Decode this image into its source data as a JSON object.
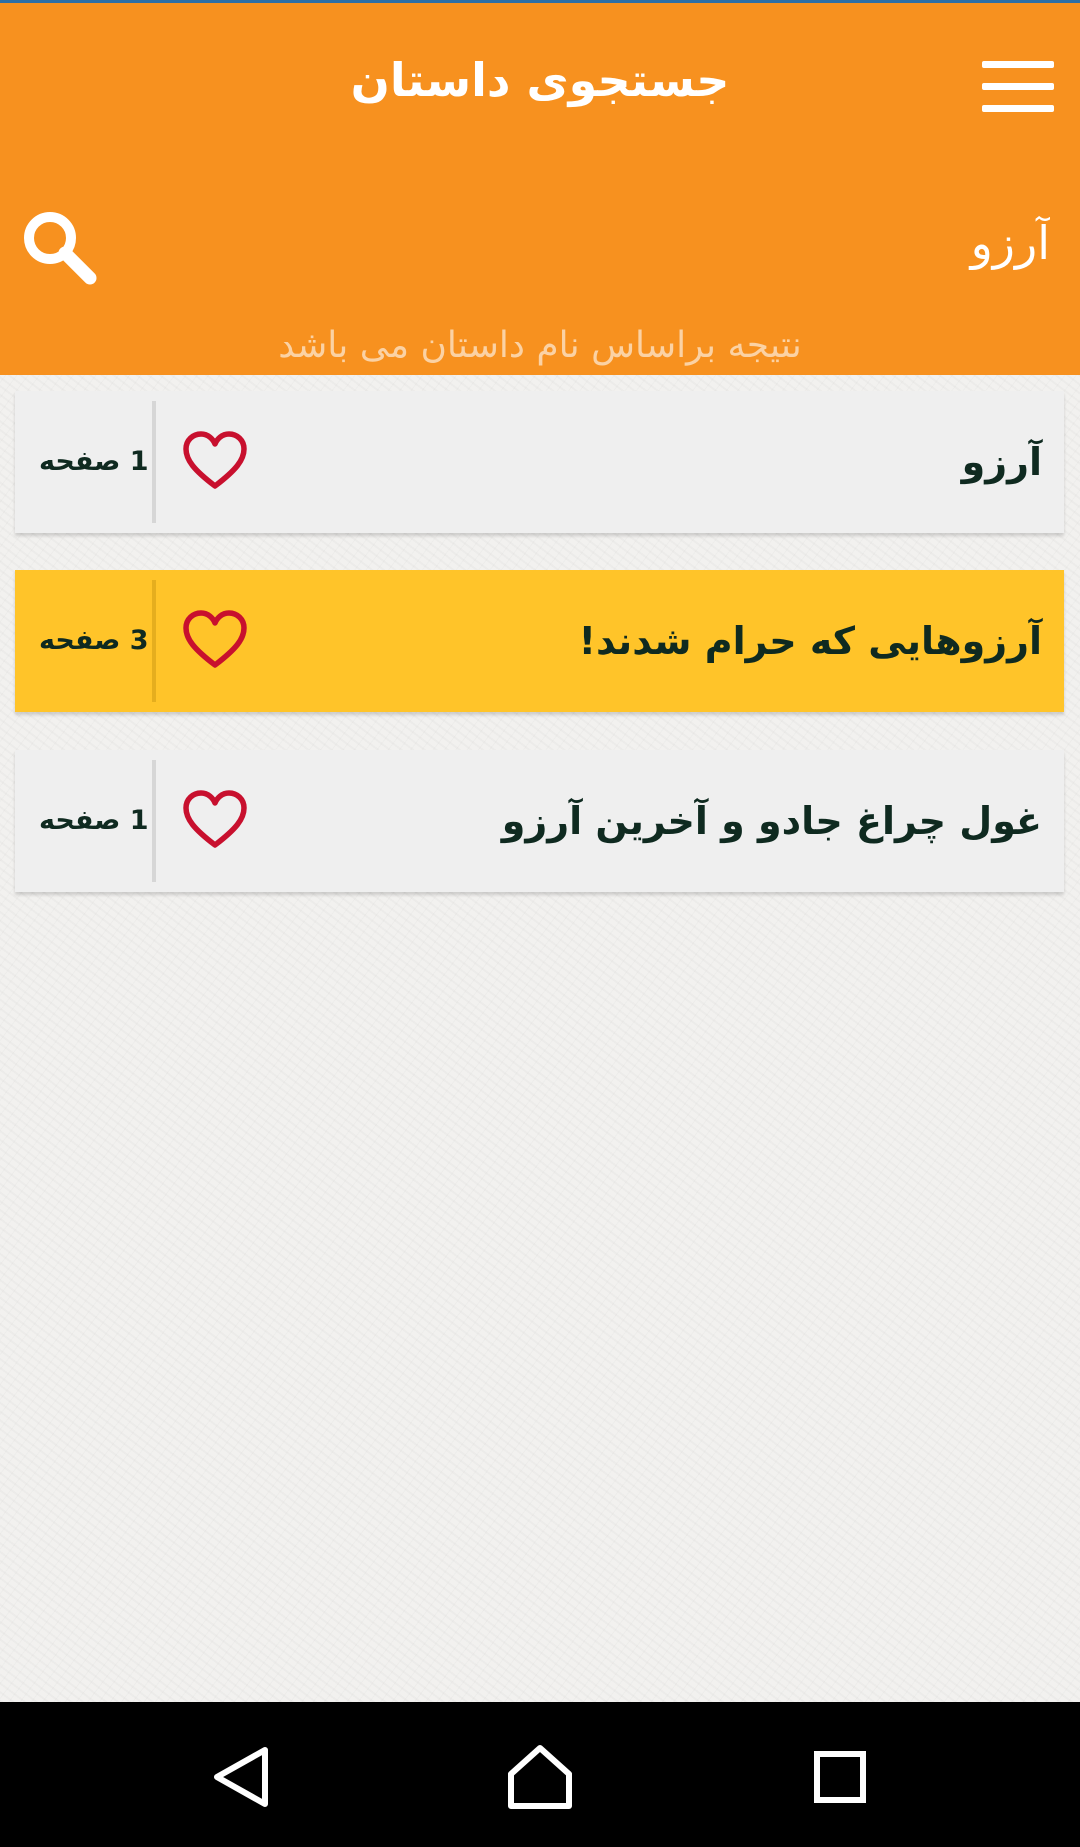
{
  "header": {
    "title": "جستجوی داستان",
    "menu_icon": "hamburger-menu-icon",
    "search_icon": "search-icon",
    "search_value": "آرزو",
    "hint": "نتیجه براساس نام داستان می باشد",
    "background_color": "#f7911f"
  },
  "results": [
    {
      "title": "آرزو",
      "pages": "1 صفحه",
      "highlighted": false,
      "icon": "heart-outline-icon"
    },
    {
      "title": "آرزوهایی که حرام شدند!",
      "pages": "3 صفحه",
      "highlighted": true,
      "icon": "heart-outline-icon"
    },
    {
      "title": "غول چراغ جادو و آخرین آرزو",
      "pages": "1 صفحه",
      "highlighted": false,
      "icon": "heart-outline-icon"
    }
  ],
  "colors": {
    "accent": "#f7911f",
    "highlight": "#ffc429",
    "heart": "#c8102e"
  },
  "navbar": {
    "back_icon": "back-triangle-icon",
    "home_icon": "home-icon",
    "recents_icon": "recents-square-icon"
  }
}
